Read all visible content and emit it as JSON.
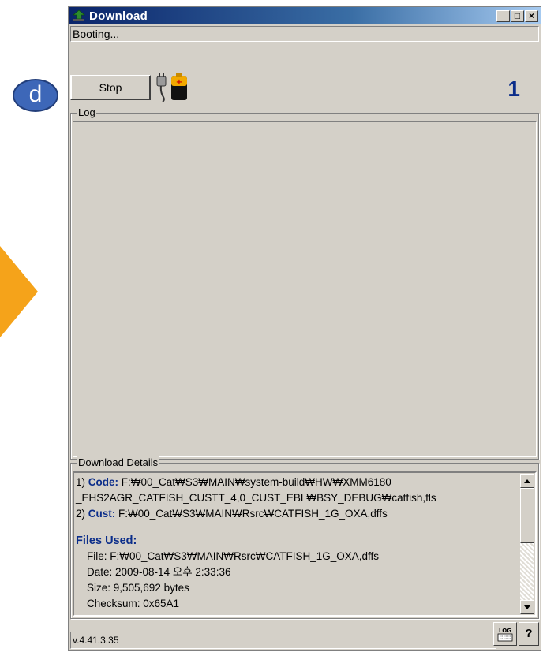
{
  "window": {
    "title": "Download"
  },
  "status": {
    "text": "Booting..."
  },
  "toolbar": {
    "stop_label": "Stop",
    "counter": "1"
  },
  "badge": {
    "letter": "d"
  },
  "log": {
    "label": "Log"
  },
  "details": {
    "label": "Download Details",
    "line1_prefix": "1) ",
    "line1_label": "Code:",
    "line1_value": " F:₩00_Cat₩S3₩MAIN₩system-build₩HW₩XMM6180",
    "line1_cont": "_EHS2AGR_CATFISH_CUSTT_4,0_CUST_EBL₩BSY_DEBUG₩catfish,fls",
    "line2_prefix": "2) ",
    "line2_label": "Cust:",
    "line2_value": " F:₩00_Cat₩S3₩MAIN₩Rsrc₩CATFISH_1G_OXA,dffs",
    "files_heading": "Files Used:",
    "file": "File: F:₩00_Cat₩S3₩MAIN₩Rsrc₩CATFISH_1G_OXA,dffs",
    "date": "Date: 2009-08-14 오후 2:33:36",
    "size": "Size: 9,505,692 bytes",
    "checksum": "Checksum: 0x65A1"
  },
  "statusbar": {
    "version": "v.4.41.3.35",
    "log_button_text": "LOG",
    "help_label": "?"
  },
  "colors": {
    "accent": "#0b2d8a",
    "titlebar": "#0a246a",
    "arrow": "#f5a31a",
    "badge": "#3d67b8"
  }
}
